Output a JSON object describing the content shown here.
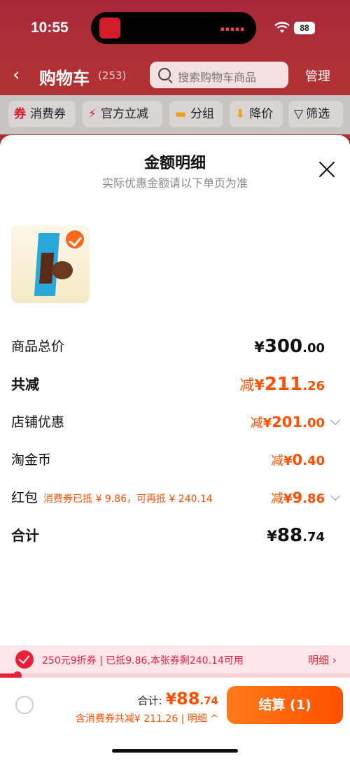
{
  "status_bar": {
    "time": "10:55",
    "battery": "88"
  },
  "nav": {
    "back_glyph": "‹",
    "title": "购物车",
    "count": "(253)",
    "search_placeholder": "搜索购物车商品",
    "manage": "管理"
  },
  "chips": [
    {
      "icon": "coupon-icon",
      "glyph": "券",
      "label": "消费券"
    },
    {
      "icon": "lightning-icon",
      "glyph": "⚡",
      "label": "官方立减"
    },
    {
      "icon": "folder-icon",
      "glyph": "▬",
      "label": "分组"
    },
    {
      "icon": "arrow-down-icon",
      "glyph": "⬇",
      "label": "降价"
    },
    {
      "icon": "filter-icon",
      "glyph": "▽",
      "label": "筛选"
    }
  ],
  "sheet": {
    "title": "金额明细",
    "subtitle": "实际优惠金额请以下单页为准",
    "rows": [
      {
        "label": "商品总价",
        "prefix": "",
        "currency": "¥",
        "int": "300",
        "dec": ".00"
      },
      {
        "label": "共减",
        "prefix": "减",
        "currency": "¥",
        "int": "211",
        "dec": ".26"
      },
      {
        "label": "店铺优惠",
        "prefix": "减",
        "currency": "¥",
        "int": "201",
        "dec": ".00"
      },
      {
        "label": "淘金币",
        "prefix": "减",
        "currency": "¥",
        "int": "0",
        "dec": ".40"
      },
      {
        "label": "红包",
        "note": "消费券已抵 ¥ 9.86，可再抵 ¥ 240.14",
        "prefix": "减",
        "currency": "¥",
        "int": "9",
        "dec": ".86"
      },
      {
        "label": "合计",
        "prefix": "",
        "currency": "¥",
        "int": "88",
        "dec": ".74"
      }
    ]
  },
  "coupon_bar": {
    "text": "250元9折券 | 已抵9.86,本张券剩240.14可用",
    "detail": "明细 ›",
    "progress_fraction": 0.05
  },
  "checkout": {
    "total_label": "合计:",
    "total_currency": "¥",
    "total_int": "88",
    "total_dec": ".74",
    "discount_text": "含消费券共减¥ 211.26 | 明细 ^",
    "button": "结算 (1)"
  },
  "colors": {
    "accent": "#ff5000",
    "red": "#e8203a"
  }
}
